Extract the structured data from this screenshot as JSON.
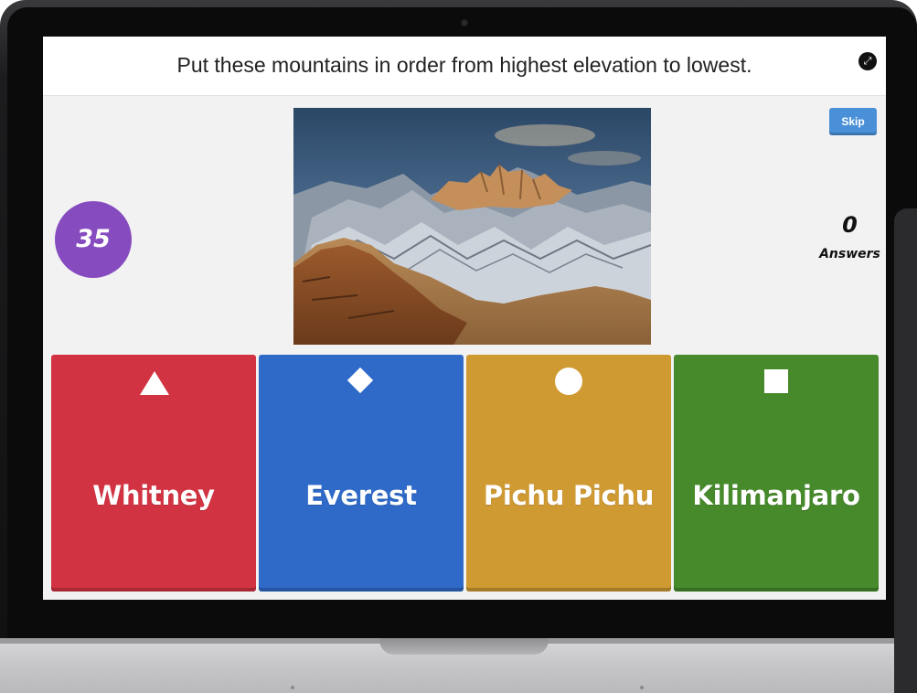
{
  "question": {
    "text": "Put these mountains in order from highest elevation to lowest."
  },
  "controls": {
    "skip_label": "Skip",
    "fullscreen_icon": "expand-icon"
  },
  "timer": {
    "value": "35"
  },
  "answers_counter": {
    "count": "0",
    "label": "Answers"
  },
  "choices": [
    {
      "label": "Whitney",
      "shape": "triangle",
      "color": "#d23342"
    },
    {
      "label": "Everest",
      "shape": "diamond",
      "color": "#2f6ac8"
    },
    {
      "label": "Pichu Pichu",
      "shape": "circle",
      "color": "#d09a33"
    },
    {
      "label": "Kilimanjaro",
      "shape": "square",
      "color": "#478a2b"
    }
  ],
  "colors": {
    "timer": "#864cbf",
    "skip": "#4a90d9"
  }
}
